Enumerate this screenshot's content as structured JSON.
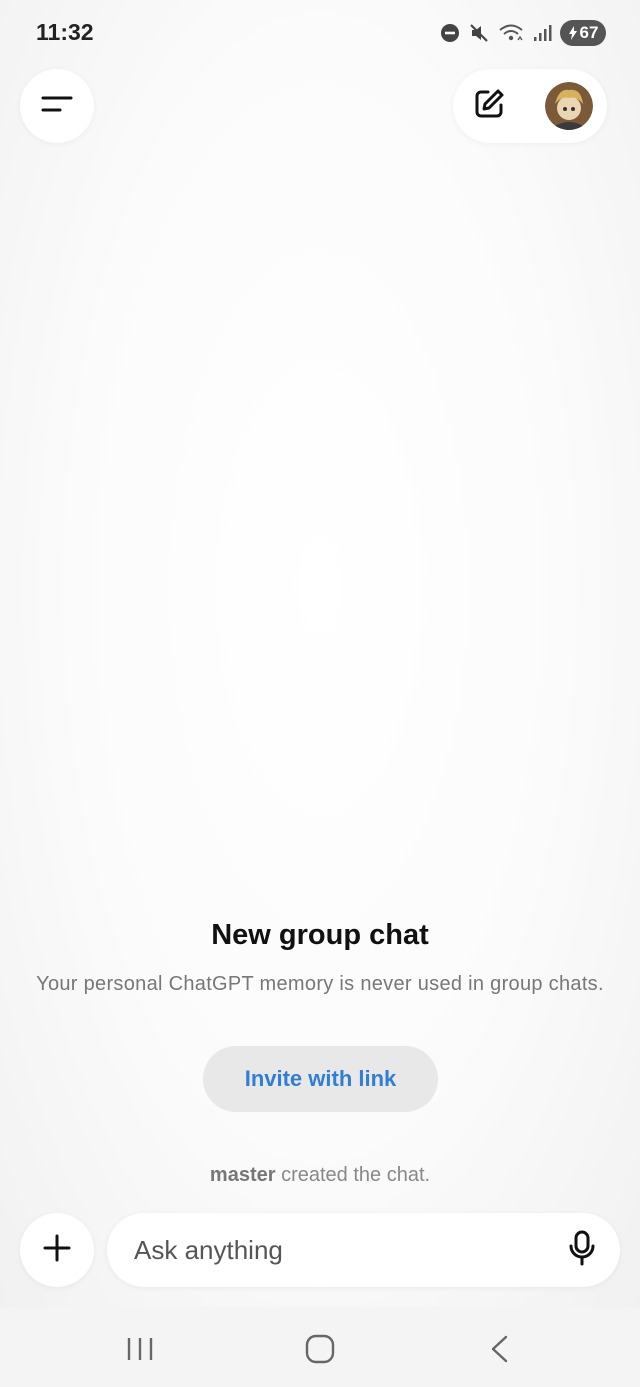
{
  "status_bar": {
    "time": "11:32",
    "battery_level": "67",
    "icons": [
      "do-not-disturb-icon",
      "mute-icon",
      "wifi-icon",
      "signal-icon",
      "battery-icon"
    ]
  },
  "header": {
    "menu_icon": "menu-icon",
    "new_chat_icon": "edit-icon",
    "avatar": "avatar"
  },
  "main": {
    "title": "New group chat",
    "subtitle": "Your personal ChatGPT memory is never used in group chats.",
    "invite_label": "Invite with link",
    "created_user": "master",
    "created_text": " created the chat."
  },
  "composer": {
    "plus_icon": "plus-icon",
    "placeholder": "Ask anything",
    "mic_icon": "mic-icon"
  },
  "nav_bar": {
    "icons": [
      "recents-icon",
      "home-icon",
      "back-icon"
    ]
  },
  "colors": {
    "accent": "#2f7fd9",
    "background": "#f4f4f4",
    "pill": "#e8e8e8"
  }
}
